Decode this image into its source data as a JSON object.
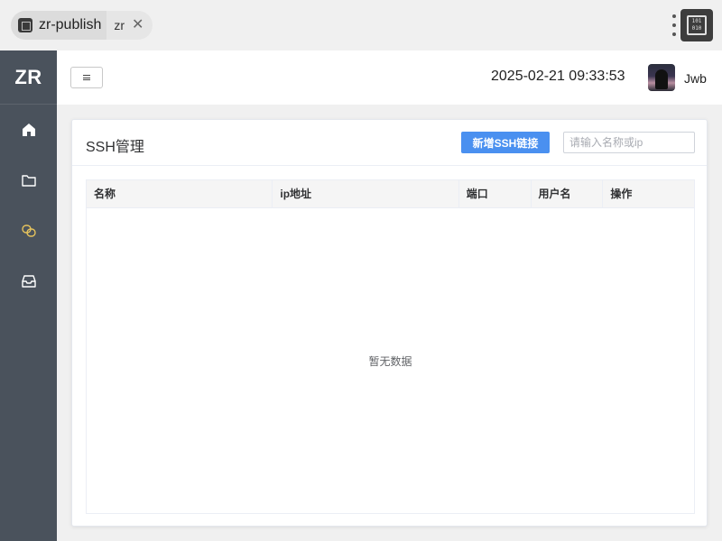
{
  "browser": {
    "tab_main_label": "zr-publish",
    "tab_sub_label": "zr",
    "close_glyph": "✕",
    "extension_glyph": "101\n010"
  },
  "sidebar": {
    "logo": "ZR",
    "items": [
      {
        "name": "home-icon",
        "color": "#ffffff",
        "active": false
      },
      {
        "name": "folder-icon",
        "color": "#ffffff",
        "active": false
      },
      {
        "name": "link-icon",
        "color": "#e6c35c",
        "active": true
      },
      {
        "name": "inbox-icon",
        "color": "#ffffff",
        "active": false
      }
    ]
  },
  "header": {
    "menu_icon": "menu-icon",
    "datetime": "2025-02-21 09:33:53",
    "username": "Jwb"
  },
  "page": {
    "title": "SSH管理",
    "add_button": "新增SSH链接",
    "search_placeholder": "请输入名称或ip",
    "search_value": ""
  },
  "table": {
    "columns": [
      "名称",
      "ip地址",
      "端口",
      "用户名",
      "操作"
    ],
    "rows": [],
    "empty_text": "暂无数据"
  },
  "colors": {
    "accent": "#4a90f0",
    "sidebar_bg": "#4a525c",
    "active_icon": "#e6c35c"
  }
}
